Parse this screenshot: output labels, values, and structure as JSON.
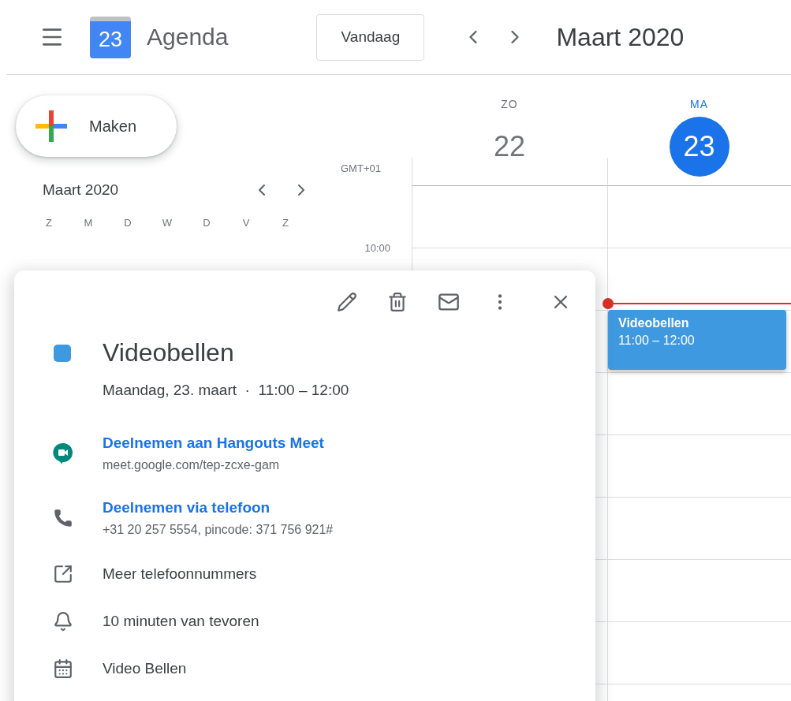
{
  "header": {
    "app_name": "Agenda",
    "logo_day": "23",
    "today_button": "Vandaag",
    "period": "Maart 2020"
  },
  "create_button": "Maken",
  "mini_calendar": {
    "month": "Maart 2020",
    "weekdays": [
      "Z",
      "M",
      "D",
      "W",
      "D",
      "V",
      "Z"
    ]
  },
  "timezone": "GMT+01",
  "time_labels": [
    "10:00"
  ],
  "days": [
    {
      "name": "ZO",
      "number": "22",
      "selected": false
    },
    {
      "name": "MA",
      "number": "23",
      "selected": true
    }
  ],
  "event": {
    "title": "Videobellen",
    "time": "11:00 – 12:00"
  },
  "popup": {
    "title": "Videobellen",
    "when": "Maandag, 23. maart  ·  11:00 – 12:00",
    "items": [
      {
        "kind": "meet",
        "link": "Deelnemen aan Hangouts Meet",
        "detail": "meet.google.com/tep-zcxe-gam"
      },
      {
        "kind": "phone",
        "link": "Deelnemen via telefoon",
        "detail": "+31 20 257 5554, pincode: 371 756 921#"
      },
      {
        "kind": "more",
        "text": "Meer telefoonnummers"
      },
      {
        "kind": "reminder",
        "text": "10 minuten van tevoren"
      },
      {
        "kind": "calendar",
        "text": "Video Bellen"
      }
    ]
  }
}
